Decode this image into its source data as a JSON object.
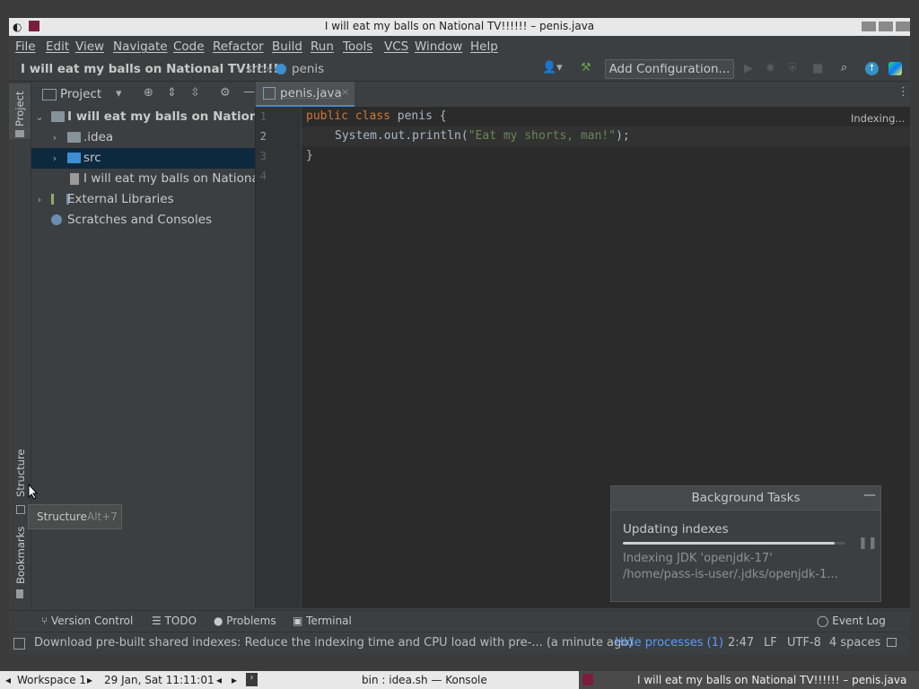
{
  "window": {
    "title": "I will eat my balls on National TV!!!!!! – penis.java"
  },
  "menu": [
    "File",
    "Edit",
    "View",
    "Navigate",
    "Code",
    "Refactor",
    "Build",
    "Run",
    "Tools",
    "VCS",
    "Window",
    "Help"
  ],
  "breadcrumb": {
    "project": "I will eat my balls on National TV!!!!!!",
    "folder": "src",
    "file": "penis"
  },
  "toolbar": {
    "config_label": "Add Configuration..."
  },
  "left_strip": {
    "project": "Project",
    "structure": "Structure",
    "bookmarks": "Bookmarks"
  },
  "project_panel": {
    "header": "Project",
    "tree": [
      {
        "label": "I will eat my balls on National TV!!!!!!",
        "bold": true
      },
      {
        "label": ".idea"
      },
      {
        "label": "src",
        "selected": true
      },
      {
        "label": "I will eat my balls on National TV!!!!!!.iml"
      },
      {
        "label": "External Libraries"
      },
      {
        "label": "Scratches and Consoles"
      }
    ]
  },
  "editor": {
    "tab": "penis.java",
    "indexing": "Indexing...",
    "line_numbers": [
      "1",
      "2",
      "3",
      "4"
    ],
    "code": {
      "l1_kw1": "public",
      "l1_kw2": "class",
      "l1_rest": "penis {",
      "l2_pre": "System.out.println(",
      "l2_str": "\"Eat my shorts, man!\"",
      "l2_post": ");",
      "l3": "}"
    }
  },
  "background_tasks": {
    "title": "Background Tasks",
    "task": "Updating indexes",
    "progress": 0.95,
    "detail1": "Indexing JDK 'openjdk-17'",
    "detail2": "/home/pass-is-user/.jdks/openjdk-1..."
  },
  "tooltip": {
    "label": "Structure",
    "shortcut": "Alt+7"
  },
  "tool_windows": {
    "version_control": "Version Control",
    "todo": "TODO",
    "problems": "Problems",
    "terminal": "Terminal",
    "event_log": "Event Log"
  },
  "status": {
    "message": "Download pre-built shared indexes: Reduce the indexing time and CPU load with pre-... (a minute ago)",
    "hide_processes": "Hide processes (1)",
    "position": "2:47",
    "line_ending": "LF",
    "encoding": "UTF-8",
    "indent": "4 spaces"
  },
  "taskbar": {
    "workspace": "Workspace 1",
    "datetime": "29 Jan, Sat 11:11:01",
    "konsole": "bin : idea.sh — Konsole",
    "active_window": "I will eat my balls on National TV!!!!!! – penis.java"
  },
  "colors": {
    "accent": "#4a88c7",
    "selection": "#0d293e",
    "keyword": "#cc7832",
    "string": "#6a8759"
  }
}
